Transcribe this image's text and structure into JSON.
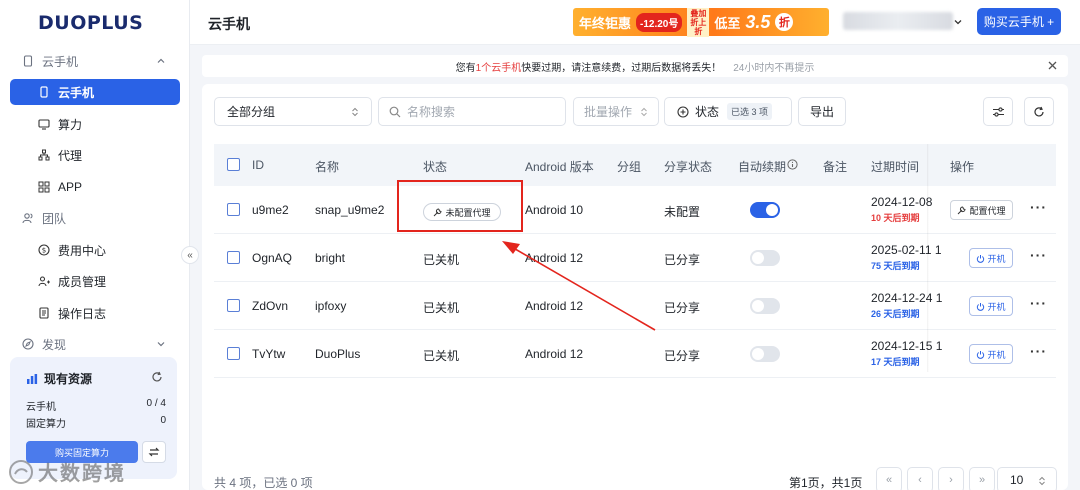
{
  "app": {
    "logo": "DUOPLUS",
    "page_title": "云手机"
  },
  "sidebar": {
    "groups": [
      {
        "label": "云手机"
      },
      {
        "label": "团队"
      },
      {
        "label": "发现"
      }
    ],
    "items": [
      {
        "label": "云手机",
        "icon": "phone-icon",
        "active": true
      },
      {
        "label": "算力",
        "icon": "monitor-icon"
      },
      {
        "label": "代理",
        "icon": "network-icon"
      },
      {
        "label": "APP",
        "icon": "grid-icon"
      },
      {
        "label": "费用中心",
        "icon": "dollar-icon"
      },
      {
        "label": "成员管理",
        "icon": "members-icon"
      },
      {
        "label": "操作日志",
        "icon": "log-icon"
      }
    ],
    "resources": {
      "title": "现有资源",
      "rows": [
        {
          "label": "云手机",
          "value": "0 / 4"
        },
        {
          "label": "固定算力",
          "value": "0"
        }
      ],
      "buy_label": "购买固定算力"
    },
    "watermark": "大数跨境"
  },
  "header": {
    "promo": {
      "t1": "年终钜惠",
      "t2": "-12.20号",
      "t3": "叠加折上折",
      "t4": "低至",
      "t5": "3.5",
      "t6": "折"
    },
    "buy_button": "购买云手机 +"
  },
  "notice": {
    "prefix": "您有",
    "highlight": "1个云手机",
    "suffix": "快要过期，请注意续费，过期后数据将丢失！",
    "sub": "24小时内不再提示"
  },
  "toolbar": {
    "group_select": "全部分组",
    "search_placeholder": "名称搜索",
    "batch_placeholder": "批量操作",
    "status_label": "状态",
    "status_badge": "已选 3 项",
    "export_label": "导出"
  },
  "table": {
    "headers": [
      "ID",
      "名称",
      "状态",
      "Android 版本",
      "分组",
      "分享状态",
      "自动续期",
      "备注",
      "过期时间",
      "操作"
    ],
    "rows": [
      {
        "id": "u9me2",
        "name": "snap_u9me2",
        "status": "未配置代理",
        "android": "Android 10",
        "share": "未配置",
        "auto_renew": true,
        "expire": "2024-12-08",
        "days": "10 天后到期",
        "days_color": "red",
        "action": "配置代理"
      },
      {
        "id": "OgnAQ",
        "name": "bright",
        "status": "已关机",
        "android": "Android 12",
        "share": "已分享",
        "auto_renew": false,
        "expire": "2025-02-11 1",
        "days": "75 天后到期",
        "days_color": "blue",
        "action": "开机"
      },
      {
        "id": "ZdOvn",
        "name": "ipfoxy",
        "status": "已关机",
        "android": "Android 12",
        "share": "已分享",
        "auto_renew": false,
        "expire": "2024-12-24 1",
        "days": "26 天后到期",
        "days_color": "blue",
        "action": "开机"
      },
      {
        "id": "TvYtw",
        "name": "DuoPlus",
        "status": "已关机",
        "android": "Android 12",
        "share": "已分享",
        "auto_renew": false,
        "expire": "2024-12-15 1",
        "days": "17 天后到期",
        "days_color": "blue",
        "action": "开机"
      }
    ]
  },
  "footer": {
    "summary": "共 4 项，已选 0 项",
    "page_text": "第1页，共1页",
    "page_size": "10"
  },
  "colors": {
    "primary": "#2a62e6",
    "danger": "#e3251d"
  }
}
